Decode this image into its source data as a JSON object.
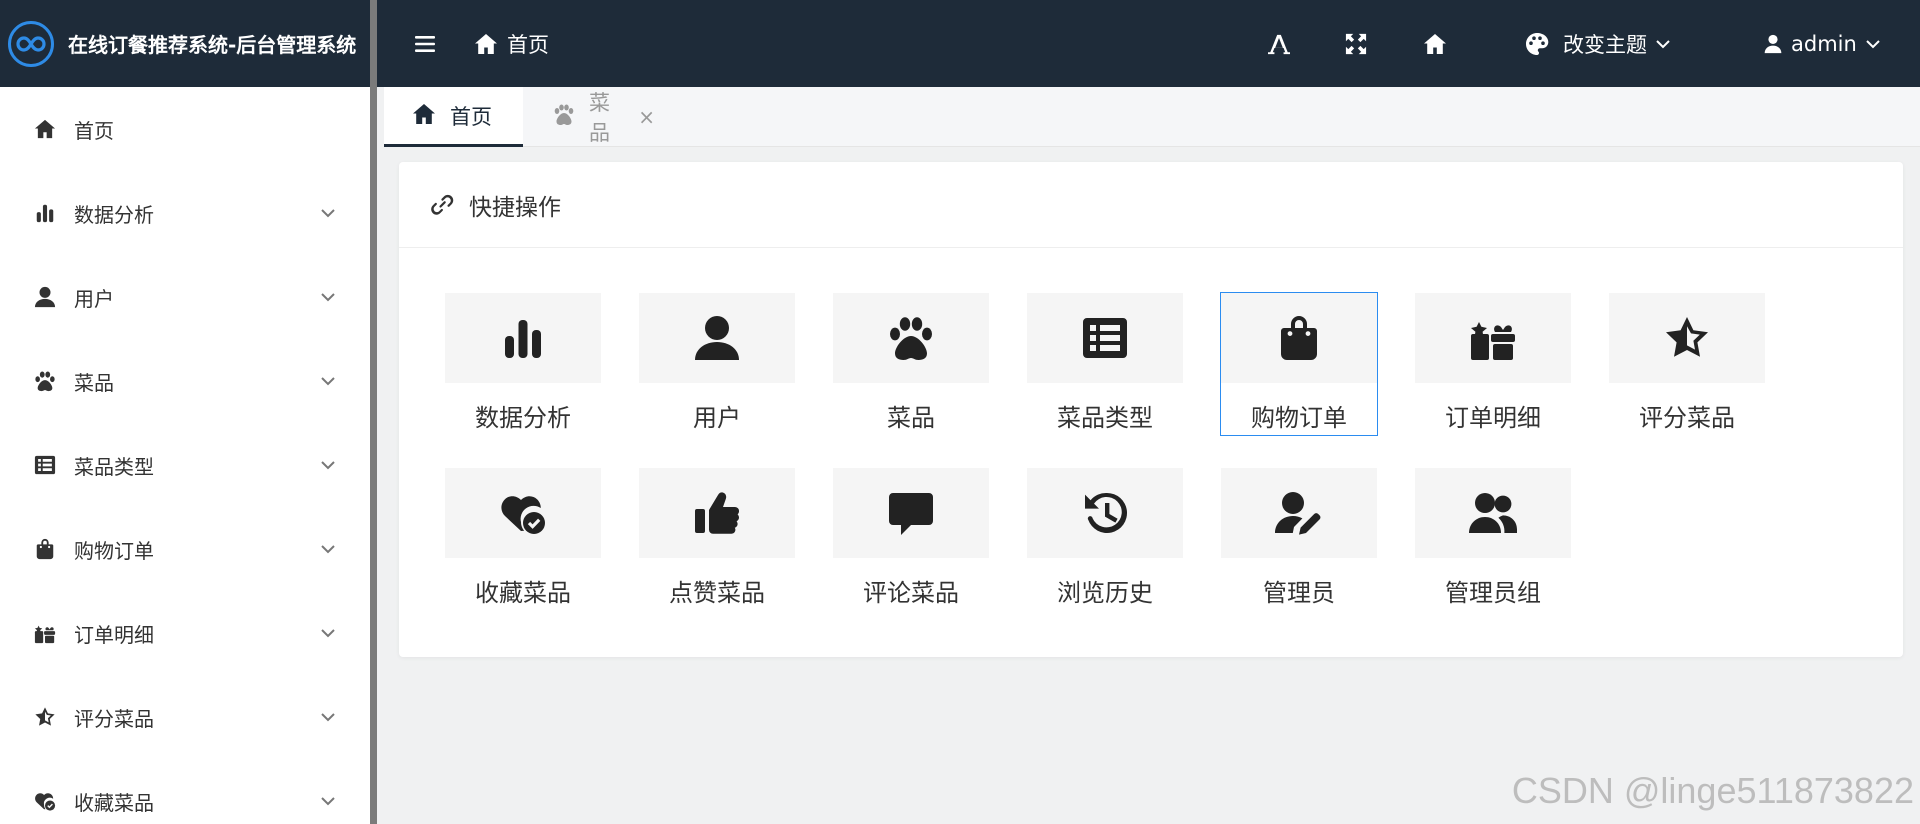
{
  "app": {
    "title": "在线订餐推荐系统-后台管理系统"
  },
  "sidebar": {
    "items": [
      {
        "label": "首页",
        "icon": "home-icon",
        "expandable": false
      },
      {
        "label": "数据分析",
        "icon": "bar-chart-icon",
        "expandable": true
      },
      {
        "label": "用户",
        "icon": "user-icon",
        "expandable": true
      },
      {
        "label": "菜品",
        "icon": "paw-icon",
        "expandable": true
      },
      {
        "label": "菜品类型",
        "icon": "list-icon",
        "expandable": true
      },
      {
        "label": "购物订单",
        "icon": "shopping-bag-icon",
        "expandable": true
      },
      {
        "label": "订单明细",
        "icon": "gift-icon",
        "expandable": true
      },
      {
        "label": "评分菜品",
        "icon": "star-icon",
        "expandable": true
      },
      {
        "label": "收藏菜品",
        "icon": "heart-check-icon",
        "expandable": true
      }
    ]
  },
  "topbar": {
    "breadcrumb": "首页",
    "theme_label": "改变主题",
    "user_label": "admin"
  },
  "tabs": [
    {
      "label": "首页",
      "icon": "home-icon",
      "active": true
    },
    {
      "label": "菜品",
      "icon": "paw-icon",
      "active": false,
      "close": "×"
    }
  ],
  "quick": {
    "title": "快捷操作",
    "items": [
      {
        "label": "数据分析",
        "icon": "bar-chart-icon"
      },
      {
        "label": "用户",
        "icon": "user-icon"
      },
      {
        "label": "菜品",
        "icon": "paw-icon"
      },
      {
        "label": "菜品类型",
        "icon": "list-icon"
      },
      {
        "label": "购物订单",
        "icon": "shopping-bag-icon",
        "selected": true
      },
      {
        "label": "订单明细",
        "icon": "gift-icon"
      },
      {
        "label": "评分菜品",
        "icon": "star-icon"
      },
      {
        "label": "收藏菜品",
        "icon": "heart-check-icon"
      },
      {
        "label": "点赞菜品",
        "icon": "thumbs-up-icon"
      },
      {
        "label": "评论菜品",
        "icon": "comment-icon"
      },
      {
        "label": "浏览历史",
        "icon": "history-icon"
      },
      {
        "label": "管理员",
        "icon": "user-edit-icon"
      },
      {
        "label": "管理员组",
        "icon": "users-icon"
      }
    ]
  },
  "watermark": "CSDN @linge511873822",
  "colors": {
    "header_bg": "#1e2b39",
    "accent": "#2b8cf0",
    "sidebar_bg": "#ffffff"
  }
}
